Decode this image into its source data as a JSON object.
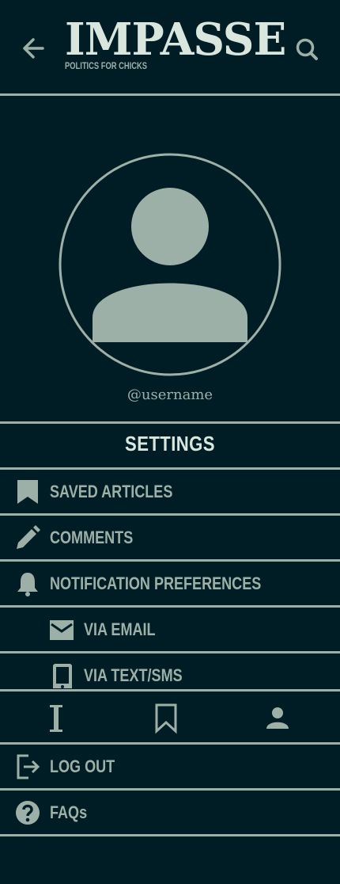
{
  "header": {
    "back_icon": "arrow-left-icon",
    "logo_title": "IMPASSE",
    "logo_tagline": "POLITICS FOR CHICKS",
    "search_icon": "search-icon"
  },
  "profile": {
    "avatar_icon": "user-avatar-icon",
    "username": "@username"
  },
  "settings": {
    "title": "SETTINGS",
    "items": [
      {
        "label": "SAVED ARTICLES",
        "icon": "bookmark-icon"
      },
      {
        "label": "COMMENTS",
        "icon": "pencil-icon"
      },
      {
        "label": "NOTIFICATION PREFERENCES",
        "icon": "bell-icon"
      },
      {
        "label": "VIA EMAIL",
        "icon": "envelope-icon"
      },
      {
        "label": "VIA TEXT/SMS",
        "icon": "phone-icon"
      }
    ]
  },
  "tabbar": {
    "items": [
      {
        "name": "home",
        "icon": "impasse-i-icon"
      },
      {
        "name": "saved",
        "icon": "bookmark-outline-icon"
      },
      {
        "name": "profile",
        "icon": "person-icon"
      }
    ]
  },
  "account": {
    "items": [
      {
        "label": "LOG OUT",
        "icon": "logout-icon"
      },
      {
        "label": "FAQs",
        "icon": "question-circle-icon"
      }
    ]
  },
  "colors": {
    "background": "#001d26",
    "foreground": "#9db0a8",
    "highlight": "#d9e6dd"
  }
}
